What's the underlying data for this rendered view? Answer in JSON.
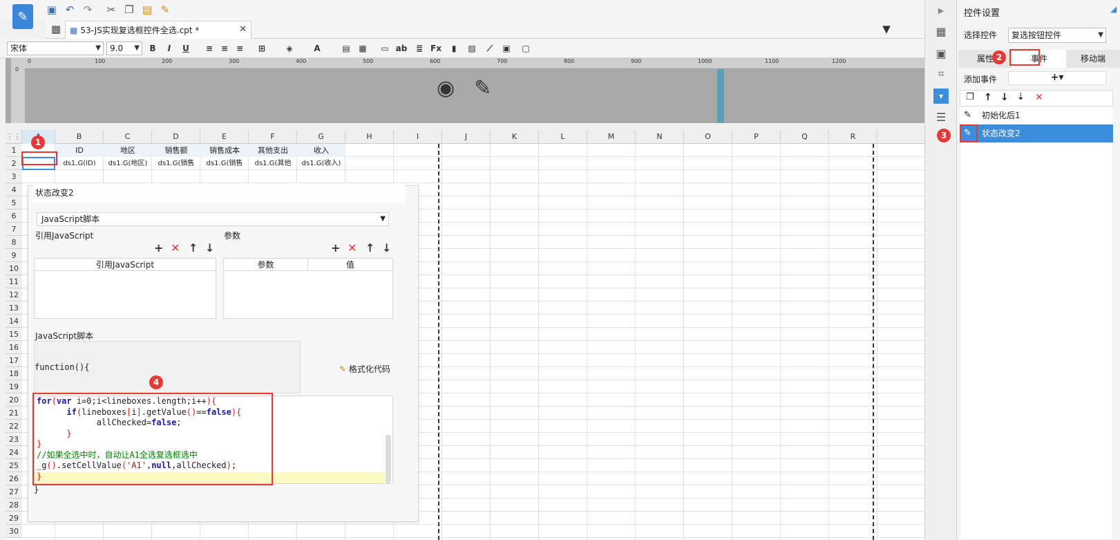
{
  "toolbar": {
    "icons": [
      "save-icon",
      "undo-icon",
      "redo-icon",
      "cut-icon",
      "copy-icon",
      "paste-icon",
      "format-brush-icon"
    ]
  },
  "tab": {
    "label": "53-JS实现复选框控件全选.cpt *",
    "close": "✕"
  },
  "format": {
    "font": "宋体",
    "size": "9.0"
  },
  "ruler": {
    "ticks": [
      "0",
      "100",
      "200",
      "300",
      "400",
      "500",
      "600",
      "700",
      "800",
      "900",
      "1000",
      "1100",
      "1200"
    ],
    "vticks": [
      "0"
    ]
  },
  "sheet": {
    "columns": [
      "A",
      "B",
      "C",
      "D",
      "E",
      "F",
      "G",
      "H",
      "I",
      "J",
      "K",
      "L",
      "M",
      "N",
      "O",
      "P",
      "Q",
      "R"
    ],
    "rows": [
      "1",
      "2",
      "3",
      "4",
      "5",
      "6",
      "7",
      "8",
      "9",
      "10",
      "11",
      "12",
      "13",
      "14",
      "15",
      "16",
      "17",
      "18",
      "19",
      "20",
      "21",
      "22",
      "23",
      "24",
      "25",
      "26",
      "27",
      "28",
      "29",
      "30"
    ],
    "header_row": [
      "",
      "ID",
      "地区",
      "销售额",
      "销售成本",
      "其他支出",
      "收入"
    ],
    "data_row": [
      "",
      "ds1.G(ID)",
      "ds1.G(地区)",
      "ds1.G(销售",
      "ds1.G(销售",
      "ds1.G(其他",
      "ds1.G(收入)"
    ]
  },
  "dialog": {
    "title": "状态改变2",
    "type_select": "JavaScript脚本",
    "ref_label": "引用JavaScript",
    "param_label": "参数",
    "ref_col": "引用JavaScript",
    "param_col": "参数",
    "value_col": "值",
    "script_label": "JavaScript脚本",
    "func_open": "function(){",
    "format_code": "格式化代码",
    "func_close": "}",
    "code": [
      "for(var i=0;i<lineboxes.length;i++){",
      "      if(lineboxes[i].getValue()==false){",
      "            allChecked=false;",
      "      }",
      "}",
      "//如果全选中时，自动让A1全选复选框选中",
      "_g().setCellValue('A1',null,allChecked);",
      "}"
    ]
  },
  "panel": {
    "title": "控件设置",
    "select_label": "选择控件",
    "select_value": "复选按钮控件",
    "tabs": [
      "属性",
      "事件",
      "移动端"
    ],
    "add_event": "添加事件",
    "events": [
      "初始化后1",
      "状态改变2"
    ]
  },
  "badges": [
    "1",
    "2",
    "3",
    "4"
  ],
  "colors": {
    "accent": "#3c8ddb",
    "highlight": "#e53935",
    "selected_row": "#3c8ddb"
  }
}
